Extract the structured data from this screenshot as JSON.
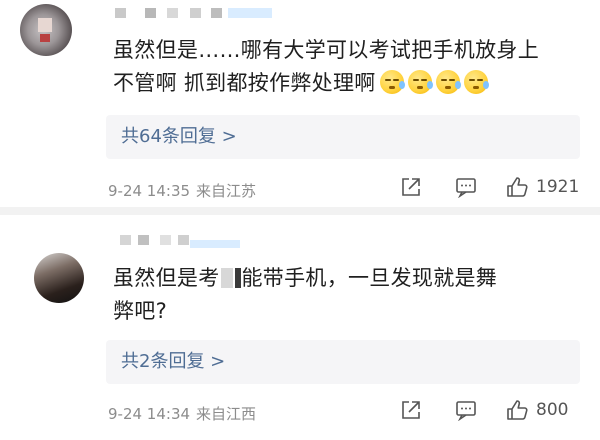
{
  "comments": [
    {
      "text_line1": "虽然但是……哪有大学可以考试把手机放身上",
      "text_line2": "不管啊 抓到都按作弊处理啊",
      "replies_label": "共64条回复 >",
      "date": "9-24 14:35",
      "location": "来自江苏",
      "likes": "1921",
      "emoji_count": 4
    },
    {
      "text_line1_a": "虽然但是考",
      "text_line1_b": "能带手机，一旦发现就是舞",
      "text_line2": "弊吧?",
      "replies_label": "共2条回复 >",
      "date": "9-24 14:34",
      "location": "来自江西",
      "likes": "800"
    }
  ],
  "icons": {
    "share": "share-icon",
    "comment": "comment-icon",
    "like": "thumbs-up-icon",
    "emoji": "sweat-face-emoji"
  }
}
